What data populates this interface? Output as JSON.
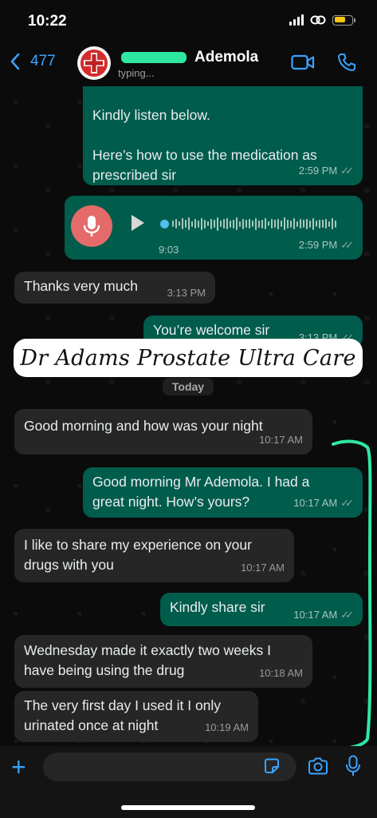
{
  "status": {
    "time": "10:22"
  },
  "header": {
    "back_count": "477",
    "contact_name": "Ademola",
    "status_text": "typing..."
  },
  "messages": [
    {
      "text_lines": [
        "Kindly listen below.",
        "",
        "Here’s how to use the medication as",
        "prescribed sir"
      ],
      "time": "2:59 PM",
      "direction": "out"
    },
    {
      "type": "audio",
      "duration": "9:03",
      "time": "2:59 PM",
      "direction": "out"
    },
    {
      "text": "Thanks very much",
      "time": "3:13 PM",
      "direction": "in"
    },
    {
      "text": "You’re welcome sir",
      "time": "3:13 PM",
      "direction": "out"
    },
    {
      "text": "Good morning and how was your night",
      "time": "10:17 AM",
      "direction": "in"
    },
    {
      "text_lines": [
        "Good morning Mr Ademola. I had a",
        "great night. How’s yours?"
      ],
      "time": "10:17 AM",
      "direction": "out"
    },
    {
      "text_lines": [
        "I like to share my experience on your",
        "drugs with you"
      ],
      "time": "10:17 AM",
      "direction": "in"
    },
    {
      "text": "Kindly share sir",
      "time": "10:17 AM",
      "direction": "out"
    },
    {
      "text_lines": [
        "Wednesday made it exactly two weeks I",
        "have being using the drug"
      ],
      "time": "10:18 AM",
      "direction": "in"
    },
    {
      "text_lines": [
        "The very first day I used it I only",
        "urinated once at night"
      ],
      "time": "10:19 AM",
      "direction": "in"
    }
  ],
  "overlay_caption": "Dr Adams Prostate Ultra Care",
  "date_divider": "Today",
  "input": {
    "placeholder": ""
  },
  "colors": {
    "outgoing_bubble": "#005c4b",
    "incoming_bubble": "#262626",
    "accent_blue": "#3aa3ff",
    "highlight_green": "#2ee8a2",
    "mic_record": "#e56b6b"
  },
  "icons": [
    "chevron-left-icon",
    "video-call-icon",
    "phone-icon",
    "play-icon",
    "microphone-icon",
    "plus-icon",
    "sticker-icon",
    "camera-icon",
    "mic-icon"
  ]
}
